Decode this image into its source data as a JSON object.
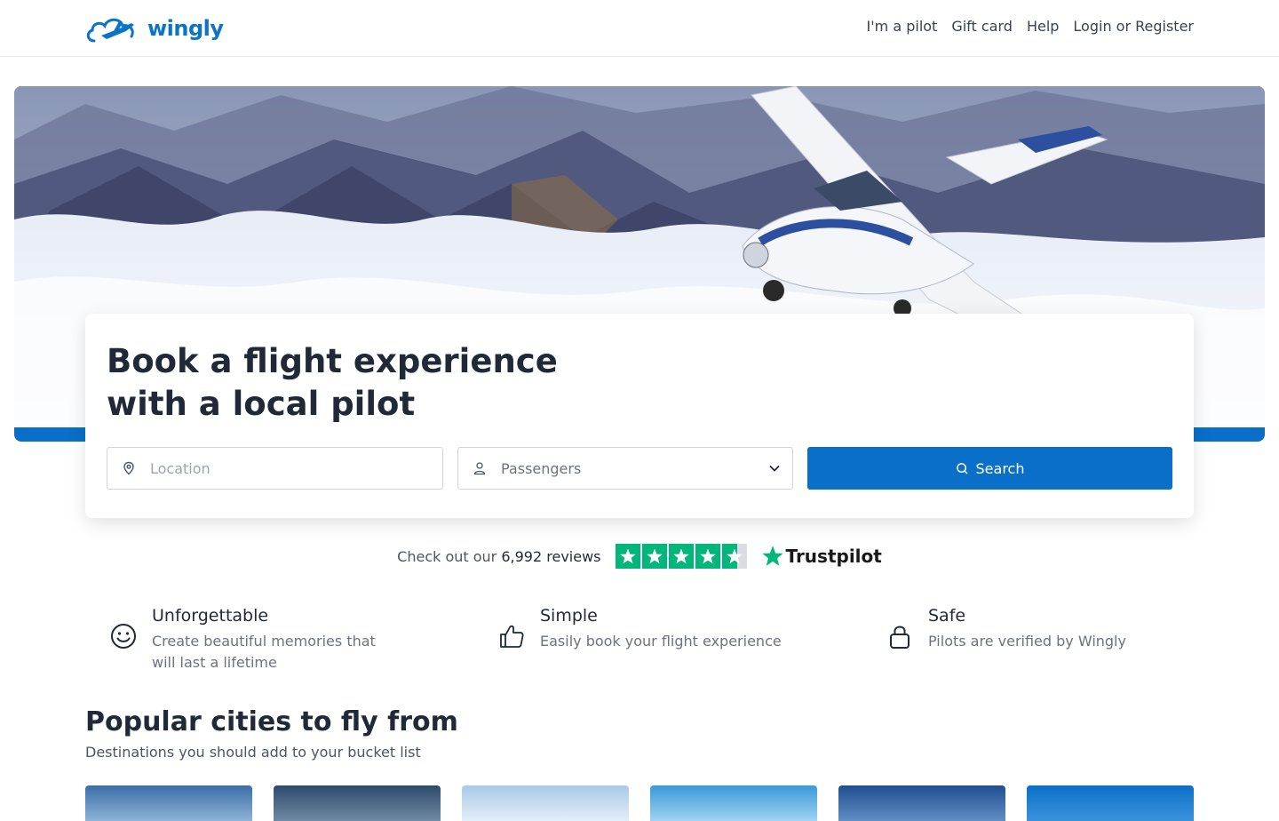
{
  "header": {
    "logo_text": "wingly",
    "nav": [
      "I'm a pilot",
      "Gift card",
      "Help",
      "Login or Register"
    ]
  },
  "hero": {
    "headline_line1": "Book a flight experience",
    "headline_line2": "with a local pilot",
    "location_placeholder": "Location",
    "passengers_placeholder": "Passengers",
    "search_label": "Search"
  },
  "reviews": {
    "prefix": "Check out our",
    "count": "6,992 reviews",
    "rating_stars": 4.5,
    "brand": "Trustpilot"
  },
  "features": [
    {
      "icon": "smiley-icon",
      "title": "Unforgettable",
      "desc": "Create beautiful memories that will last a lifetime"
    },
    {
      "icon": "thumbs-up-icon",
      "title": "Simple",
      "desc": "Easily book your flight experience"
    },
    {
      "icon": "lock-icon",
      "title": "Safe",
      "desc": "Pilots are verified by Wingly"
    }
  ],
  "popular": {
    "title": "Popular cities to fly from",
    "subtitle": "Destinations you should add to your bucket list"
  },
  "colors": {
    "brand": "#0a6fc8",
    "trustpilot": "#00b67a"
  }
}
